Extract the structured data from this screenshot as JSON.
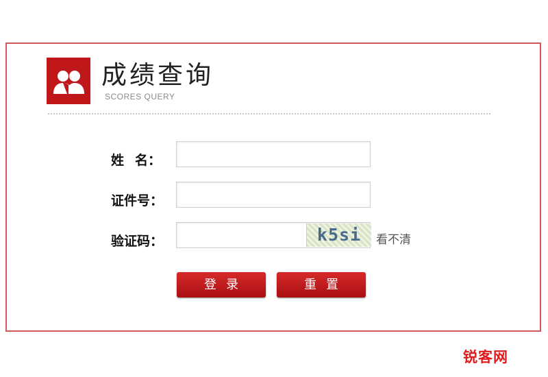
{
  "header": {
    "title": "成绩查询",
    "subtitle": "SCORES QUERY",
    "logo_icon": "users-icon"
  },
  "form": {
    "name_label_a": "姓",
    "name_label_b": "名：",
    "id_label": "证件号：",
    "captcha_label": "验证码：",
    "captcha_text": "k5si",
    "refresh_text": "看不清"
  },
  "buttons": {
    "login": "登录",
    "reset": "重置"
  },
  "watermark": "锐客网",
  "colors": {
    "accent": "#c0171b",
    "border": "#d45a5a"
  }
}
